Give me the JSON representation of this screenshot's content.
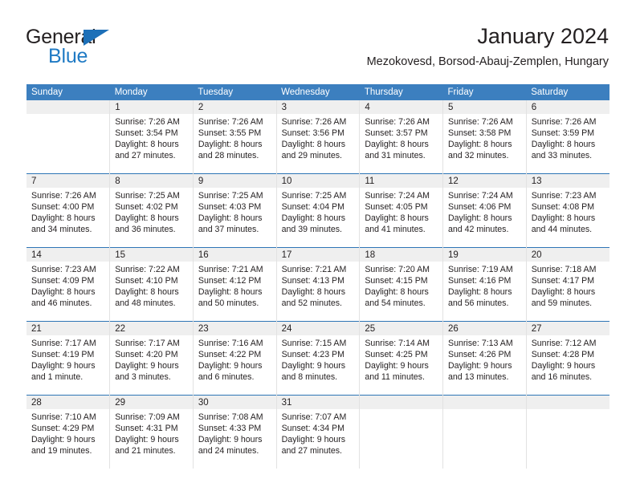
{
  "brand": {
    "name_top": "General",
    "name_bottom": "Blue",
    "accent_color": "#1f7ac4",
    "flag_color": "#1d70b8"
  },
  "header": {
    "title": "January 2024",
    "subtitle": "Mezokovesd, Borsod-Abauj-Zemplen, Hungary"
  },
  "theme": {
    "header_blue": "#3c7fbf",
    "row_divider_blue": "#2e75b6",
    "daynum_band": "#efefef",
    "text": "#231f20"
  },
  "weekday_headers": [
    "Sunday",
    "Monday",
    "Tuesday",
    "Wednesday",
    "Thursday",
    "Friday",
    "Saturday"
  ],
  "weeks": [
    [
      {
        "day": "",
        "sunrise": "",
        "sunset": "",
        "daylight1": "",
        "daylight2": "",
        "empty": true
      },
      {
        "day": "1",
        "sunrise": "Sunrise: 7:26 AM",
        "sunset": "Sunset: 3:54 PM",
        "daylight1": "Daylight: 8 hours",
        "daylight2": "and 27 minutes."
      },
      {
        "day": "2",
        "sunrise": "Sunrise: 7:26 AM",
        "sunset": "Sunset: 3:55 PM",
        "daylight1": "Daylight: 8 hours",
        "daylight2": "and 28 minutes."
      },
      {
        "day": "3",
        "sunrise": "Sunrise: 7:26 AM",
        "sunset": "Sunset: 3:56 PM",
        "daylight1": "Daylight: 8 hours",
        "daylight2": "and 29 minutes."
      },
      {
        "day": "4",
        "sunrise": "Sunrise: 7:26 AM",
        "sunset": "Sunset: 3:57 PM",
        "daylight1": "Daylight: 8 hours",
        "daylight2": "and 31 minutes."
      },
      {
        "day": "5",
        "sunrise": "Sunrise: 7:26 AM",
        "sunset": "Sunset: 3:58 PM",
        "daylight1": "Daylight: 8 hours",
        "daylight2": "and 32 minutes."
      },
      {
        "day": "6",
        "sunrise": "Sunrise: 7:26 AM",
        "sunset": "Sunset: 3:59 PM",
        "daylight1": "Daylight: 8 hours",
        "daylight2": "and 33 minutes."
      }
    ],
    [
      {
        "day": "7",
        "sunrise": "Sunrise: 7:26 AM",
        "sunset": "Sunset: 4:00 PM",
        "daylight1": "Daylight: 8 hours",
        "daylight2": "and 34 minutes."
      },
      {
        "day": "8",
        "sunrise": "Sunrise: 7:25 AM",
        "sunset": "Sunset: 4:02 PM",
        "daylight1": "Daylight: 8 hours",
        "daylight2": "and 36 minutes."
      },
      {
        "day": "9",
        "sunrise": "Sunrise: 7:25 AM",
        "sunset": "Sunset: 4:03 PM",
        "daylight1": "Daylight: 8 hours",
        "daylight2": "and 37 minutes."
      },
      {
        "day": "10",
        "sunrise": "Sunrise: 7:25 AM",
        "sunset": "Sunset: 4:04 PM",
        "daylight1": "Daylight: 8 hours",
        "daylight2": "and 39 minutes."
      },
      {
        "day": "11",
        "sunrise": "Sunrise: 7:24 AM",
        "sunset": "Sunset: 4:05 PM",
        "daylight1": "Daylight: 8 hours",
        "daylight2": "and 41 minutes."
      },
      {
        "day": "12",
        "sunrise": "Sunrise: 7:24 AM",
        "sunset": "Sunset: 4:06 PM",
        "daylight1": "Daylight: 8 hours",
        "daylight2": "and 42 minutes."
      },
      {
        "day": "13",
        "sunrise": "Sunrise: 7:23 AM",
        "sunset": "Sunset: 4:08 PM",
        "daylight1": "Daylight: 8 hours",
        "daylight2": "and 44 minutes."
      }
    ],
    [
      {
        "day": "14",
        "sunrise": "Sunrise: 7:23 AM",
        "sunset": "Sunset: 4:09 PM",
        "daylight1": "Daylight: 8 hours",
        "daylight2": "and 46 minutes."
      },
      {
        "day": "15",
        "sunrise": "Sunrise: 7:22 AM",
        "sunset": "Sunset: 4:10 PM",
        "daylight1": "Daylight: 8 hours",
        "daylight2": "and 48 minutes."
      },
      {
        "day": "16",
        "sunrise": "Sunrise: 7:21 AM",
        "sunset": "Sunset: 4:12 PM",
        "daylight1": "Daylight: 8 hours",
        "daylight2": "and 50 minutes."
      },
      {
        "day": "17",
        "sunrise": "Sunrise: 7:21 AM",
        "sunset": "Sunset: 4:13 PM",
        "daylight1": "Daylight: 8 hours",
        "daylight2": "and 52 minutes."
      },
      {
        "day": "18",
        "sunrise": "Sunrise: 7:20 AM",
        "sunset": "Sunset: 4:15 PM",
        "daylight1": "Daylight: 8 hours",
        "daylight2": "and 54 minutes."
      },
      {
        "day": "19",
        "sunrise": "Sunrise: 7:19 AM",
        "sunset": "Sunset: 4:16 PM",
        "daylight1": "Daylight: 8 hours",
        "daylight2": "and 56 minutes."
      },
      {
        "day": "20",
        "sunrise": "Sunrise: 7:18 AM",
        "sunset": "Sunset: 4:17 PM",
        "daylight1": "Daylight: 8 hours",
        "daylight2": "and 59 minutes."
      }
    ],
    [
      {
        "day": "21",
        "sunrise": "Sunrise: 7:17 AM",
        "sunset": "Sunset: 4:19 PM",
        "daylight1": "Daylight: 9 hours",
        "daylight2": "and 1 minute."
      },
      {
        "day": "22",
        "sunrise": "Sunrise: 7:17 AM",
        "sunset": "Sunset: 4:20 PM",
        "daylight1": "Daylight: 9 hours",
        "daylight2": "and 3 minutes."
      },
      {
        "day": "23",
        "sunrise": "Sunrise: 7:16 AM",
        "sunset": "Sunset: 4:22 PM",
        "daylight1": "Daylight: 9 hours",
        "daylight2": "and 6 minutes."
      },
      {
        "day": "24",
        "sunrise": "Sunrise: 7:15 AM",
        "sunset": "Sunset: 4:23 PM",
        "daylight1": "Daylight: 9 hours",
        "daylight2": "and 8 minutes."
      },
      {
        "day": "25",
        "sunrise": "Sunrise: 7:14 AM",
        "sunset": "Sunset: 4:25 PM",
        "daylight1": "Daylight: 9 hours",
        "daylight2": "and 11 minutes."
      },
      {
        "day": "26",
        "sunrise": "Sunrise: 7:13 AM",
        "sunset": "Sunset: 4:26 PM",
        "daylight1": "Daylight: 9 hours",
        "daylight2": "and 13 minutes."
      },
      {
        "day": "27",
        "sunrise": "Sunrise: 7:12 AM",
        "sunset": "Sunset: 4:28 PM",
        "daylight1": "Daylight: 9 hours",
        "daylight2": "and 16 minutes."
      }
    ],
    [
      {
        "day": "28",
        "sunrise": "Sunrise: 7:10 AM",
        "sunset": "Sunset: 4:29 PM",
        "daylight1": "Daylight: 9 hours",
        "daylight2": "and 19 minutes."
      },
      {
        "day": "29",
        "sunrise": "Sunrise: 7:09 AM",
        "sunset": "Sunset: 4:31 PM",
        "daylight1": "Daylight: 9 hours",
        "daylight2": "and 21 minutes."
      },
      {
        "day": "30",
        "sunrise": "Sunrise: 7:08 AM",
        "sunset": "Sunset: 4:33 PM",
        "daylight1": "Daylight: 9 hours",
        "daylight2": "and 24 minutes."
      },
      {
        "day": "31",
        "sunrise": "Sunrise: 7:07 AM",
        "sunset": "Sunset: 4:34 PM",
        "daylight1": "Daylight: 9 hours",
        "daylight2": "and 27 minutes."
      },
      {
        "day": "",
        "sunrise": "",
        "sunset": "",
        "daylight1": "",
        "daylight2": "",
        "empty": true
      },
      {
        "day": "",
        "sunrise": "",
        "sunset": "",
        "daylight1": "",
        "daylight2": "",
        "empty": true
      },
      {
        "day": "",
        "sunrise": "",
        "sunset": "",
        "daylight1": "",
        "daylight2": "",
        "empty": true
      }
    ]
  ]
}
